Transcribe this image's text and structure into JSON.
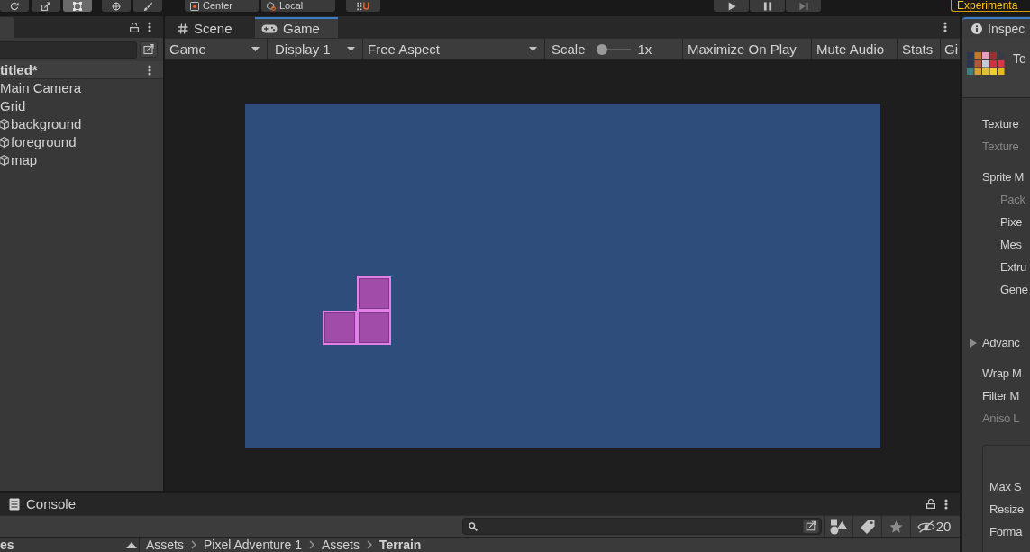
{
  "toolbar": {
    "tools": [
      {
        "kind": "rotate",
        "selected": false
      },
      {
        "kind": "scale",
        "selected": false
      },
      {
        "kind": "rect",
        "selected": true
      },
      {
        "kind": "transform",
        "selected": false
      },
      {
        "kind": "custom",
        "selected": false
      }
    ],
    "handles": [
      {
        "kind": "pivot",
        "label": "Center"
      },
      {
        "kind": "space",
        "label": "Local"
      }
    ],
    "notice": "Experimenta"
  },
  "hierarchy": {
    "scene": "titled*",
    "items": [
      {
        "label": "Main Camera"
      },
      {
        "label": "Grid",
        "children": [
          {
            "label": "background"
          },
          {
            "label": "foreground"
          },
          {
            "label": "map"
          }
        ]
      }
    ]
  },
  "game": {
    "tabs": [
      {
        "kind": "scene",
        "label": "Scene",
        "selected": false
      },
      {
        "kind": "game",
        "label": "Game",
        "selected": true
      }
    ],
    "toolbar": [
      {
        "kind": "dropdown",
        "label": "Game"
      },
      {
        "kind": "dropdown",
        "label": "Display 1"
      },
      {
        "kind": "dropdown",
        "label": "Free Aspect"
      },
      {
        "kind": "slider",
        "label": "Scale",
        "level": 0,
        "reading": "1x"
      },
      {
        "kind": "toggle",
        "label": "Maximize On Play"
      },
      {
        "kind": "toggle",
        "label": "Mute Audio"
      },
      {
        "kind": "toggle",
        "label": "Stats"
      },
      {
        "kind": "toggle",
        "label": "Gi"
      }
    ]
  },
  "inspector": {
    "tab": "Inspec",
    "title": "Te",
    "sections": [
      {
        "items": [
          {
            "kind": "property",
            "label": "Texture",
            "disabled": false
          },
          {
            "kind": "property",
            "label": "Texture",
            "disabled": true
          }
        ]
      },
      {
        "items": [
          {
            "kind": "property",
            "label": "Sprite M",
            "disabled": false,
            "children": [
              {
                "label": "Pack",
                "disabled": true
              },
              {
                "label": "Pixe",
                "disabled": false
              },
              {
                "label": "Mes",
                "disabled": false
              },
              {
                "label": "Extru",
                "disabled": false
              },
              {
                "label": "Gene",
                "disabled": false
              }
            ]
          }
        ]
      },
      {
        "items": [
          {
            "kind": "foldout",
            "label": "Advanc",
            "expanded": false
          }
        ]
      },
      {
        "items": [
          {
            "kind": "property",
            "label": "Wrap M",
            "disabled": false
          },
          {
            "kind": "property",
            "label": "Filter M",
            "disabled": false
          },
          {
            "kind": "property",
            "label": "Aniso L",
            "disabled": true
          }
        ]
      }
    ],
    "platform_settings": [
      {
        "label": "Max S"
      },
      {
        "label": "Resize"
      },
      {
        "label": "Forma"
      }
    ]
  },
  "console": {
    "tab": "Console"
  },
  "project": {
    "hidden_count": "20",
    "tree_label": "es",
    "breadcrumb": [
      {
        "label": "Assets",
        "current": false
      },
      {
        "label": "Pixel Adventure 1",
        "current": false
      },
      {
        "label": "Assets",
        "current": false
      },
      {
        "label": "Terrain",
        "current": true
      }
    ]
  }
}
